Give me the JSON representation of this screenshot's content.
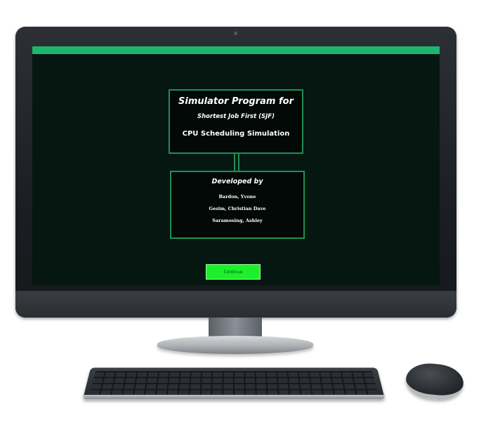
{
  "window": {
    "title_line1": "Simulator Program for",
    "title_line2": "Shortest Job First (SJF)",
    "title_line3": "CPU Scheduling Simulation"
  },
  "developers": {
    "heading": "Developed by",
    "names": [
      "Bardon, Yvone",
      "Gesim, Christian Dave",
      "Saramosing, Ashley"
    ]
  },
  "actions": {
    "continue_label": "Continue"
  },
  "colors": {
    "screen_background": "#051710",
    "accent_bar": "#1db66f",
    "panel_border": "#1f8f57",
    "button": "#1cf02c"
  }
}
